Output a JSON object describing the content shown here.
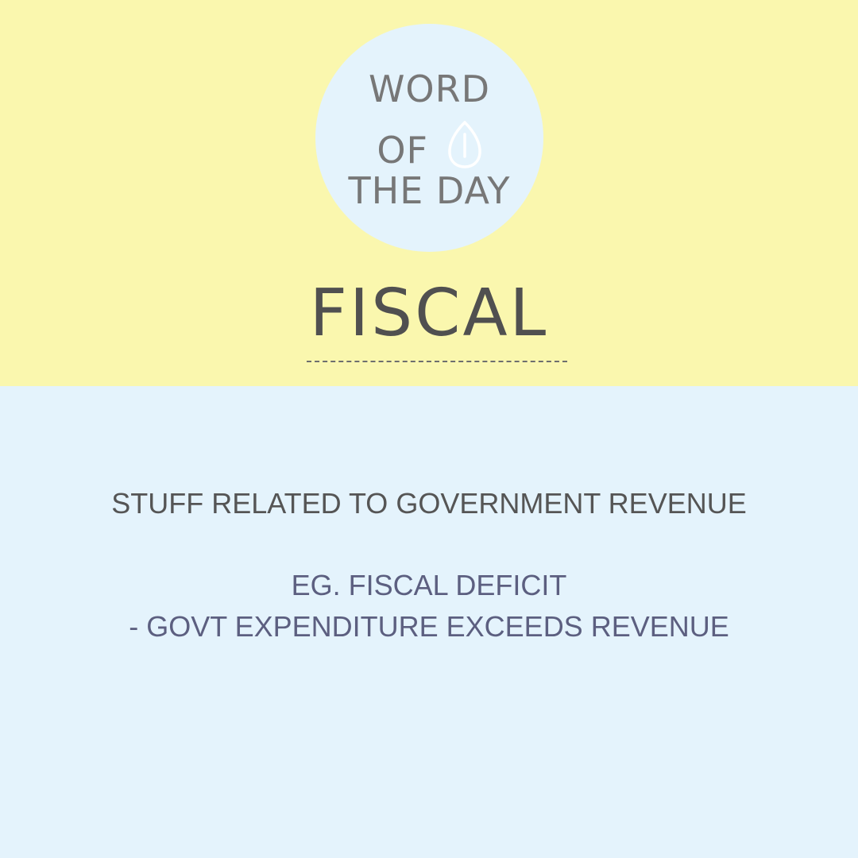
{
  "badge": {
    "line1": "WORD",
    "line2": "OF",
    "line3": "THE DAY",
    "icon": "leaf-seed-icon"
  },
  "word": "FISCAL",
  "definition": "STUFF RELATED TO GOVERNMENT REVENUE",
  "example": {
    "line1": "EG. FISCAL DEFICIT",
    "line2": "- GOVT EXPENDITURE EXCEEDS REVENUE"
  },
  "colors": {
    "top_background": "#faf7ae",
    "bottom_background": "#e4f3fc",
    "badge_text": "#777777",
    "headword": "#505050",
    "definition_text": "#555555",
    "example_text": "#5c5f80"
  }
}
